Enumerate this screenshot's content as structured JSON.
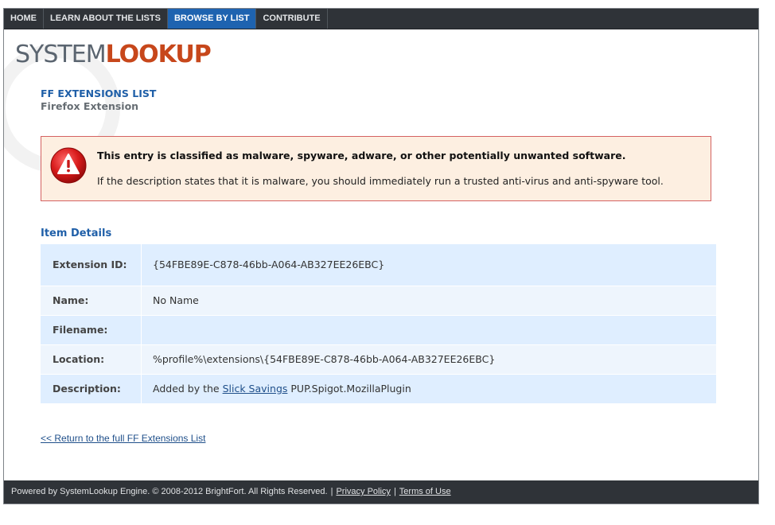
{
  "nav": {
    "items": [
      {
        "label": "HOME",
        "active": false
      },
      {
        "label": "LEARN ABOUT THE LISTS",
        "active": false
      },
      {
        "label": "BROWSE BY LIST",
        "active": true
      },
      {
        "label": "CONTRIBUTE",
        "active": false
      }
    ]
  },
  "logo": {
    "part1": "SYSTEM",
    "part2": "LOOKUP"
  },
  "page": {
    "title": "FF EXTENSIONS LIST",
    "subtitle": "Firefox Extension"
  },
  "alert": {
    "icon": "warning-exclamation-icon",
    "title": "This entry is classified as malware, spyware, adware, or other potentially unwanted software.",
    "text": "If the description states that it is malware, you should immediately run a trusted anti-virus and anti-spyware tool."
  },
  "details": {
    "heading": "Item Details",
    "rows": [
      {
        "key": "Extension ID:",
        "value": "{54FBE89E-C878-46bb-A064-AB327EE26EBC}"
      },
      {
        "key": "Name:",
        "value": "No Name"
      },
      {
        "key": "Filename:",
        "value": ""
      },
      {
        "key": "Location:",
        "value": "%profile%\\extensions\\{54FBE89E-C878-46bb-A064-AB327EE26EBC}"
      },
      {
        "key": "Description:",
        "value_prefix": "Added by the ",
        "value_link": "Slick Savings",
        "value_suffix": " PUP.Spigot.MozillaPlugin"
      }
    ]
  },
  "return_link": "<< Return to the full FF Extensions List",
  "footer": {
    "text": "Powered by SystemLookup Engine. © 2008-2012 BrightFort. All Rights Reserved.",
    "sep1": "|",
    "privacy": "Privacy Policy",
    "sep2": "|",
    "terms": "Terms of Use"
  },
  "colors": {
    "accent": "#1e63b0",
    "brand": "#c7471b",
    "alert_border": "#d46262",
    "alert_bg": "#fdefe1"
  }
}
